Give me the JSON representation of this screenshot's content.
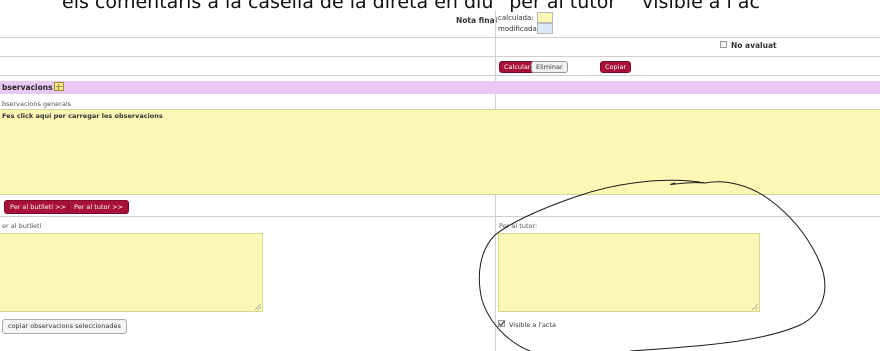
{
  "heading": {
    "text": "els comentaris a la casella de la direta en diu “per al tutor” “visible a l’ac"
  },
  "nota_final": {
    "label": "Nota final",
    "calculada_label": "calculada:",
    "modificada_label": "modificada:",
    "calculada_color": "#fdf7b6",
    "modificada_color": "#dbe9f6"
  },
  "no_avaluat": {
    "label": "No avaluat",
    "checked": false
  },
  "actions": {
    "calcular": "Calcular",
    "eliminar": "Eliminar",
    "copiar": "Copiar"
  },
  "observacions": {
    "title": "bservacions",
    "header_color": "#e9c9f3",
    "general_label": "bservacions generals",
    "general_placeholder": "Fes click aquí per carregar les observacions",
    "to_butlleti_button": "Per al butlletí >>",
    "to_tutor_button": "Per al tutor >>",
    "butlleti_label": "er al butlletí",
    "tutor_label": "Per al tutor:",
    "copy_selected_button": "copiar observacions seleccionades",
    "visible_acta_label": "Visible a l'acta",
    "visible_acta_checked": true
  },
  "accent_color": "#a8123a",
  "textarea_color": "#fdf7b6"
}
